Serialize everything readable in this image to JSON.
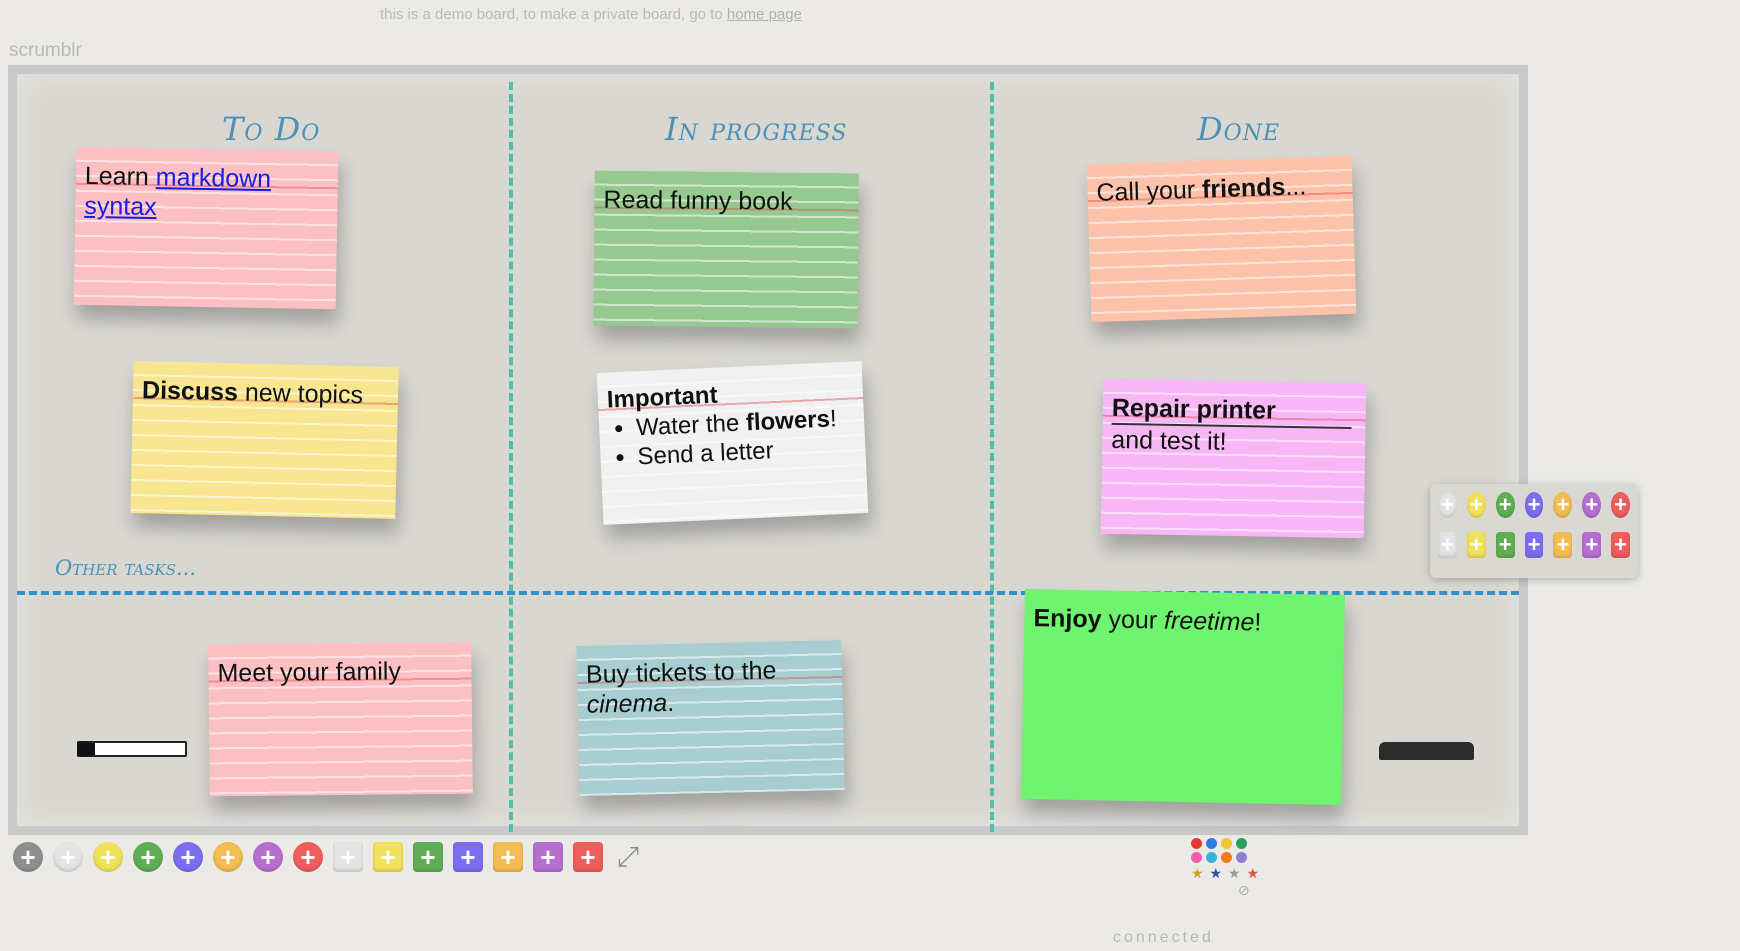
{
  "top_note": {
    "text": "this is a demo board, to make a private board, go to",
    "link": "home page"
  },
  "logo": "scrumblr",
  "board": {
    "columns": [
      "To Do",
      "In progress",
      "Done"
    ],
    "other_label": "Other tasks..."
  },
  "cards": {
    "learn": {
      "prefix": "Learn",
      "link1": "markdown",
      "link2": "syntax"
    },
    "read": "Read funny book",
    "call": {
      "prefix": "Call your",
      "bold": "friends",
      "suffix": "..."
    },
    "discuss": {
      "bold": "Discuss",
      "rest": "new topics"
    },
    "important": {
      "title": "Important",
      "item1_a": "Water the",
      "item1_b": "flowers",
      "item1_c": "!",
      "item2": "Send a letter"
    },
    "repair": {
      "title": "Repair printer",
      "rest": "and test it!"
    },
    "meet": "Meet your family",
    "buy": {
      "line1": "Buy tickets to the",
      "italic": "cinema",
      "dot": "."
    },
    "enjoy": {
      "bold": "Enjoy",
      "mid": "your",
      "italic": "freetime",
      "end": "!"
    }
  },
  "colors": {
    "grey": "#9a9a9a",
    "white": "#e8e8e8",
    "yellow": "#f2e45b",
    "green": "#5fae54",
    "blue": "#7b6ef0",
    "orange": "#f2bd52",
    "purple": "#b66fd0",
    "red": "#ef5d5d"
  },
  "status": "connected"
}
